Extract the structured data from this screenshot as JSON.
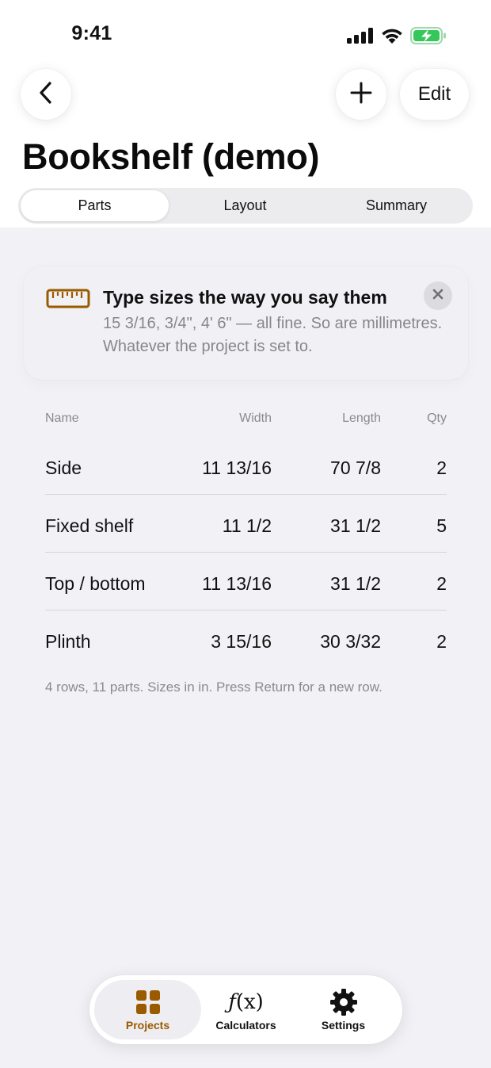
{
  "status_bar": {
    "time": "9:41",
    "icons": [
      "signal-icon",
      "wifi-icon",
      "battery-charging-icon"
    ]
  },
  "nav": {
    "back_icon": "chevron-left-icon",
    "add_icon": "plus-icon",
    "edit_label": "Edit"
  },
  "page": {
    "title": "Bookshelf (demo)"
  },
  "tabs": [
    {
      "label": "Parts",
      "active": true
    },
    {
      "label": "Layout",
      "active": false
    },
    {
      "label": "Summary",
      "active": false
    }
  ],
  "tip": {
    "icon": "ruler-icon",
    "title": "Type sizes the way you say them",
    "body": "15 3/16, 3/4\", 4' 6\" — all fine. So are millimetres. Whatever the project is set to.",
    "close_icon": "close-icon"
  },
  "parts_table": {
    "columns": {
      "name": "Name",
      "width": "Width",
      "length": "Length",
      "qty": "Qty"
    },
    "rows": [
      {
        "name": "Side",
        "width": "11 13/16",
        "length": "70 7/8",
        "qty": "2"
      },
      {
        "name": "Fixed shelf",
        "width": "11 1/2",
        "length": "31 1/2",
        "qty": "5"
      },
      {
        "name": "Top / bottom",
        "width": "11 13/16",
        "length": "31 1/2",
        "qty": "2"
      },
      {
        "name": "Plinth",
        "width": "3 15/16",
        "length": "30 3/32",
        "qty": "2"
      }
    ],
    "footnote": "4 rows, 11 parts. Sizes in in. Press Return for a new row."
  },
  "tab_bar": {
    "items": [
      {
        "label": "Projects",
        "icon": "grid-icon",
        "active": true
      },
      {
        "label": "Calculators",
        "icon": "function-icon",
        "active": false
      },
      {
        "label": "Settings",
        "icon": "gear-icon",
        "active": false
      }
    ]
  },
  "colors": {
    "accent": "#9a5a00",
    "battery_green": "#34c759",
    "background": "#f2f1f6"
  }
}
